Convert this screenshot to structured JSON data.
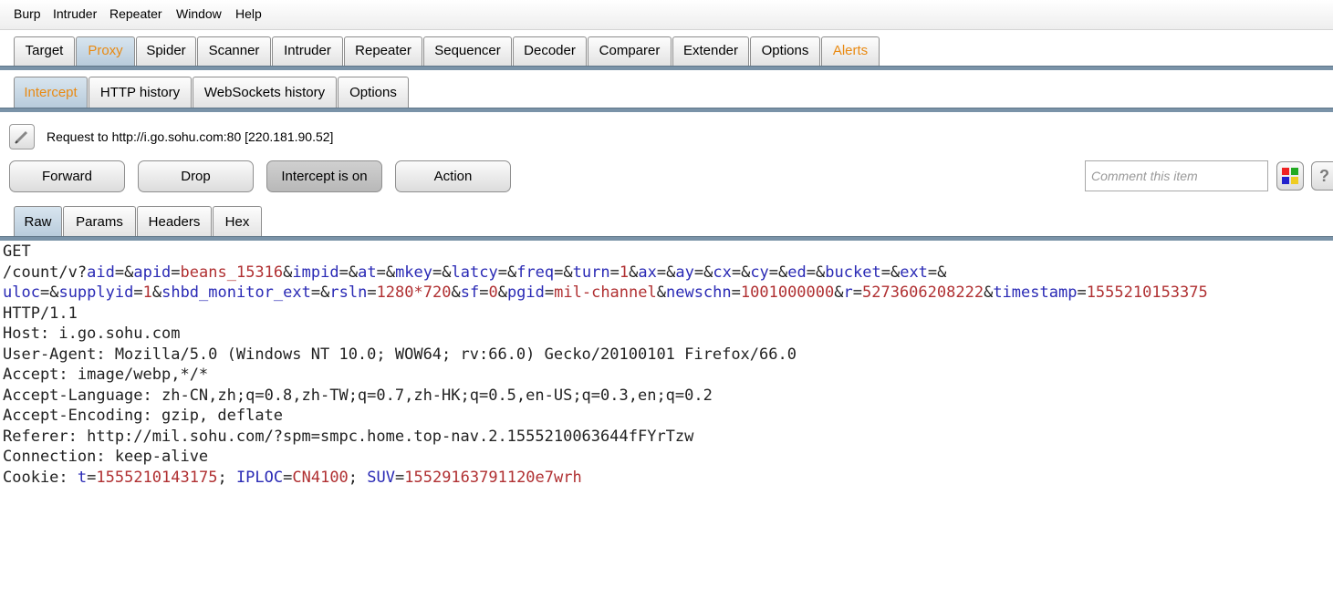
{
  "menu": [
    "Burp",
    "Intruder",
    "Repeater",
    "Window",
    "Help"
  ],
  "main_tabs": [
    "Target",
    "Proxy",
    "Spider",
    "Scanner",
    "Intruder",
    "Repeater",
    "Sequencer",
    "Decoder",
    "Comparer",
    "Extender",
    "Options",
    "Alerts"
  ],
  "proxy_tabs": [
    "Intercept",
    "HTTP history",
    "WebSockets history",
    "Options"
  ],
  "request_label": "Request to http://i.go.sohu.com:80  [220.181.90.52]",
  "buttons": {
    "forward": "Forward",
    "drop": "Drop",
    "intercept": "Intercept is on",
    "action": "Action"
  },
  "comment_placeholder": "Comment this item",
  "help_label": "?",
  "message_tabs": [
    "Raw",
    "Params",
    "Headers",
    "Hex"
  ],
  "colors": {
    "active_tab_text": "#e98a12",
    "param_name": "#2a2ab5",
    "param_value": "#b03032"
  },
  "request": {
    "method": "GET",
    "path": "/count/v?",
    "query": [
      [
        "aid",
        ""
      ],
      [
        "apid",
        "beans_15316"
      ],
      [
        "impid",
        ""
      ],
      [
        "at",
        ""
      ],
      [
        "mkey",
        ""
      ],
      [
        "latcy",
        ""
      ],
      [
        "freq",
        ""
      ],
      [
        "turn",
        "1"
      ],
      [
        "ax",
        ""
      ],
      [
        "ay",
        ""
      ],
      [
        "cx",
        ""
      ],
      [
        "cy",
        ""
      ],
      [
        "ed",
        ""
      ],
      [
        "bucket",
        ""
      ],
      [
        "ext",
        ""
      ],
      [
        "uloc",
        ""
      ],
      [
        "supplyid",
        "1"
      ],
      [
        "shbd_monitor_ext",
        ""
      ],
      [
        "rsln",
        "1280*720"
      ],
      [
        "sf",
        "0"
      ],
      [
        "pgid",
        "mil-channel"
      ],
      [
        "newschn",
        "1001000000"
      ],
      [
        "r",
        "5273606208222"
      ],
      [
        "timestamp",
        "1555210153375"
      ]
    ],
    "version": "HTTP/1.1",
    "headers": [
      "Host: i.go.sohu.com",
      "User-Agent: Mozilla/5.0 (Windows NT 10.0; WOW64; rv:66.0) Gecko/20100101 Firefox/66.0",
      "Accept: image/webp,*/*",
      "Accept-Language: zh-CN,zh;q=0.8,zh-TW;q=0.7,zh-HK;q=0.5,en-US;q=0.3,en;q=0.2",
      "Accept-Encoding: gzip, deflate",
      "Referer: http://mil.sohu.com/?spm=smpc.home.top-nav.2.1555210063644fFYrTzw",
      "Connection: keep-alive"
    ],
    "cookie_label": "Cookie: ",
    "cookies": [
      [
        "t",
        "1555210143175"
      ],
      [
        "IPLOC",
        "CN4100"
      ],
      [
        "SUV",
        "15529163791120e7wrh"
      ]
    ]
  }
}
